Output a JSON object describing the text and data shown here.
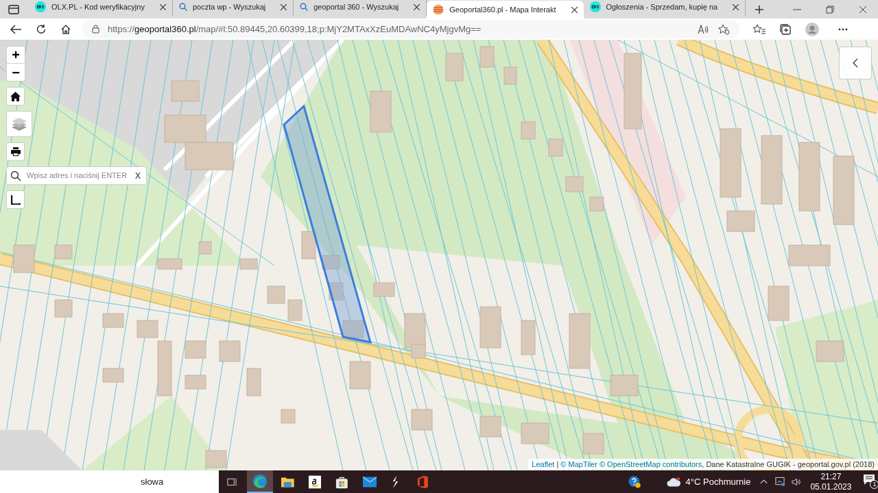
{
  "browser": {
    "tabs": [
      {
        "kind": "olx",
        "title": "OLX.PL - Kod weryfikacyjny",
        "selected": false
      },
      {
        "kind": "search",
        "title": "poczta wp - Wyszukaj",
        "selected": false
      },
      {
        "kind": "search",
        "title": "geoportal 360 - Wyszukaj",
        "selected": false
      },
      {
        "kind": "geoportal",
        "title": "Geoportal360.pl - Mapa Interakt",
        "selected": true
      },
      {
        "kind": "olx",
        "title": "Ogłoszenia - Sprzedam, kupię na",
        "selected": false
      }
    ],
    "address": {
      "scheme": "https://",
      "host": "geoportal360.pl",
      "path": "/map/#l:50.89445,20.60399,18;p:MjY2MTAxXzEuMDAwNC4yMjgvMg=="
    }
  },
  "map": {
    "zoom_in": "+",
    "zoom_out": "−",
    "search": {
      "placeholder": "Wpisz adres i naciśnij ENTER",
      "clear": "X"
    },
    "attribution": {
      "leaflet": "Leaflet",
      "separator": "|",
      "maptiler": "© MapTiler",
      "osm": "© OpenStreetMap contributors",
      "rest": ", Dane Katastralne GUGIK - geoportal.gov.pl (2018)"
    }
  },
  "taskbar": {
    "search_text": "słowa",
    "weather": "4°C Pochmurnie",
    "time": "21:27",
    "date": "05.01.2023",
    "notifications": "1"
  }
}
